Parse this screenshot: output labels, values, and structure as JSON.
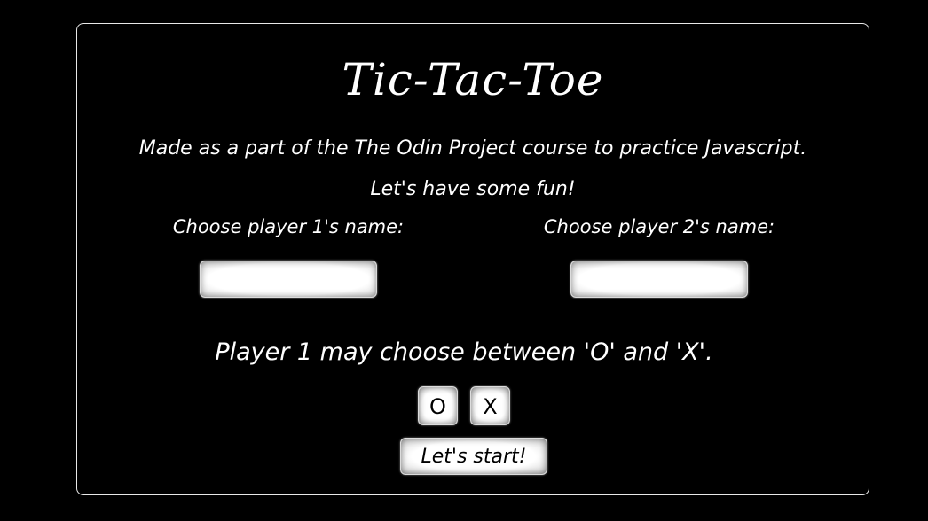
{
  "header": {
    "title": "Tic-Tac-Toe",
    "subtitle": "Made as a part of the The Odin Project course to practice Javascript.",
    "tagline": "Let's have some fun!"
  },
  "players": {
    "player1": {
      "label": "Choose player 1's name:",
      "value": "",
      "placeholder": ""
    },
    "player2": {
      "label": "Choose player 2's name:",
      "value": "",
      "placeholder": ""
    }
  },
  "symbol_choice": {
    "prompt": "Player 1 may choose between 'O' and 'X'.",
    "options": [
      "O",
      "X"
    ]
  },
  "start_button": {
    "label": "Let's start!"
  },
  "colors": {
    "background": "#000000",
    "text": "#ffffff",
    "card_border": "#e8e8e8",
    "button_bg": "#ffffff",
    "button_text": "#000000"
  }
}
